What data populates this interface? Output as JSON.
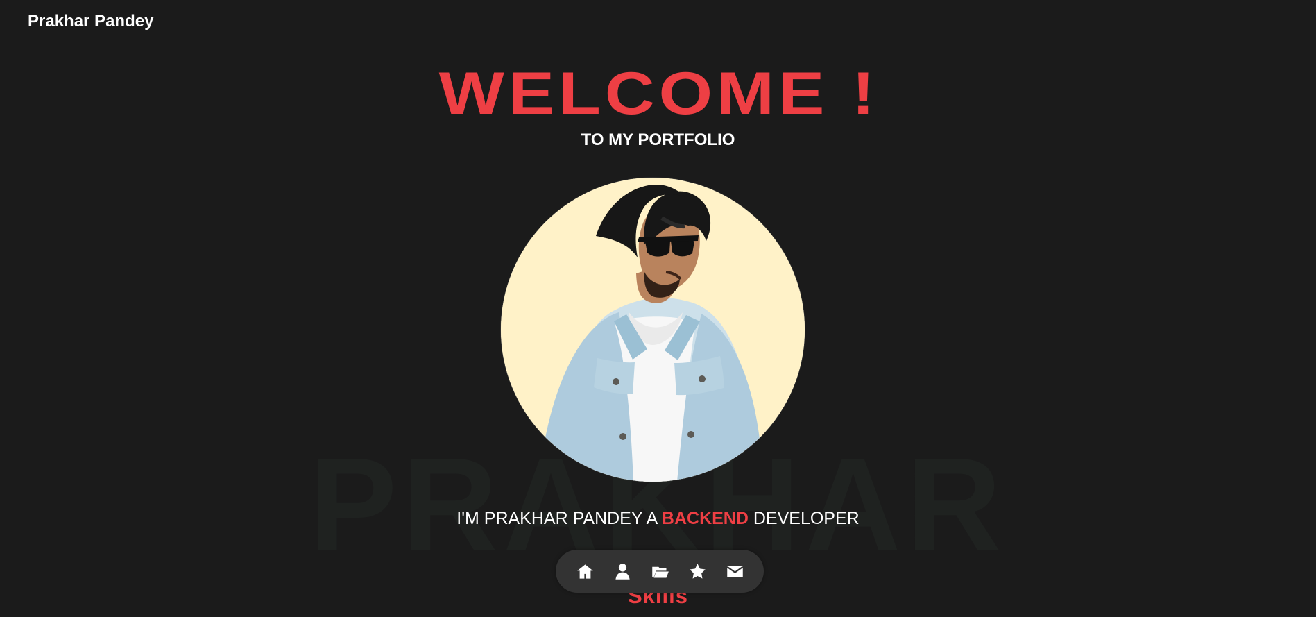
{
  "header": {
    "brand": "Prakhar Pandey"
  },
  "hero": {
    "welcome": "WELCOME !",
    "subtitle": "TO MY PORTFOLIO",
    "background_name": "PRAKHAR",
    "intro_prefix": "I'M PRAKHAR PANDEY A",
    "intro_highlight": "BACKEND",
    "intro_suffix": "DEVELOPER"
  },
  "sections": {
    "skills_title": "Skills"
  },
  "dock": {
    "items": [
      {
        "icon": "home-icon"
      },
      {
        "icon": "user-icon"
      },
      {
        "icon": "folder-open-icon"
      },
      {
        "icon": "star-icon"
      },
      {
        "icon": "envelope-icon"
      }
    ]
  },
  "colors": {
    "background": "#1b1b1b",
    "accent": "#ee3f44",
    "text": "#ffffff",
    "dock": "#333333",
    "avatar_background": "#fff2c8"
  }
}
